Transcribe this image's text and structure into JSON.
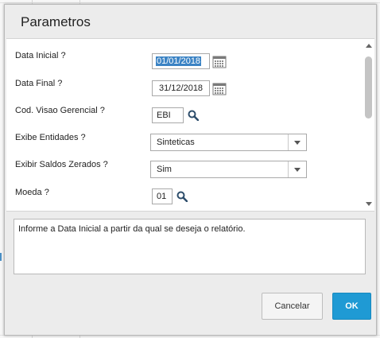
{
  "dialog": {
    "title": "Parametros"
  },
  "params": [
    {
      "label": "Data Inicial ?",
      "value": "01/01/2018",
      "type": "date"
    },
    {
      "label": "Data Final ?",
      "value": "31/12/2018",
      "type": "date"
    },
    {
      "label": "Cod. Visao Gerencial ?",
      "value": "EBI",
      "type": "lookup"
    },
    {
      "label": "Exibe Entidades ?",
      "value": "Sinteticas",
      "type": "select"
    },
    {
      "label": "Exibir Saldos Zerados ?",
      "value": "Sim",
      "type": "select"
    },
    {
      "label": "Moeda ?",
      "value": "01",
      "type": "lookup"
    }
  ],
  "help": {
    "text": "Informe a Data Inicial a partir da qual se deseja o relatório."
  },
  "buttons": {
    "cancel": "Cancelar",
    "ok": "OK"
  },
  "colors": {
    "accent": "#1f9ad4",
    "selection": "#3b83c4"
  },
  "icons": [
    "calendar-icon",
    "search-icon",
    "chevron-down-icon",
    "scroll-up-icon",
    "scroll-down-icon"
  ]
}
